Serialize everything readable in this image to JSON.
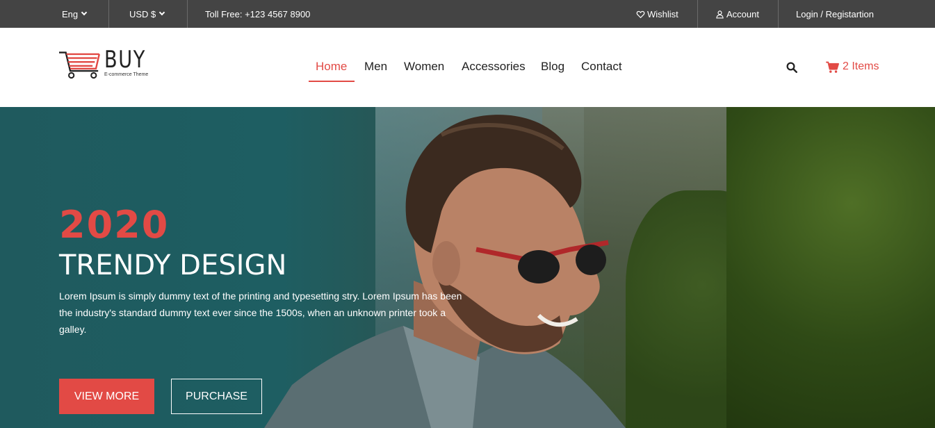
{
  "topbar": {
    "language": "Eng",
    "currency": "USD $",
    "toll_free": "Toll Free: +123 4567 8900",
    "wishlist": "Wishlist",
    "account": "Account",
    "login": "Login / Registartion"
  },
  "logo": {
    "word": "BUY",
    "tagline": "E-commerce Theme"
  },
  "nav": {
    "items": [
      {
        "label": "Home",
        "active": true
      },
      {
        "label": "Men"
      },
      {
        "label": "Women"
      },
      {
        "label": "Accessories"
      },
      {
        "label": "Blog"
      },
      {
        "label": "Contact"
      }
    ]
  },
  "cart": {
    "label": "2 Items"
  },
  "hero": {
    "year": "2020",
    "title": "TRENDY DESIGN",
    "text": "Lorem Ipsum is simply dummy text of the printing and typesetting stry. Lorem Ipsum has been the industry's standard dummy text ever since the 1500s, when an unknown printer took a galley.",
    "view_more": "VIEW MORE",
    "purchase": "PURCHASE"
  },
  "icons": {
    "language_dropdown": "chevron-down-icon",
    "currency_dropdown": "chevron-down-icon",
    "wishlist": "heart-icon",
    "account": "user-icon",
    "search": "search-icon",
    "cart": "shopping-cart-icon",
    "logo": "shopping-cart-logo"
  },
  "colors": {
    "accent": "#e24a45",
    "topbar_bg": "#444444",
    "text_dark": "#222222"
  }
}
